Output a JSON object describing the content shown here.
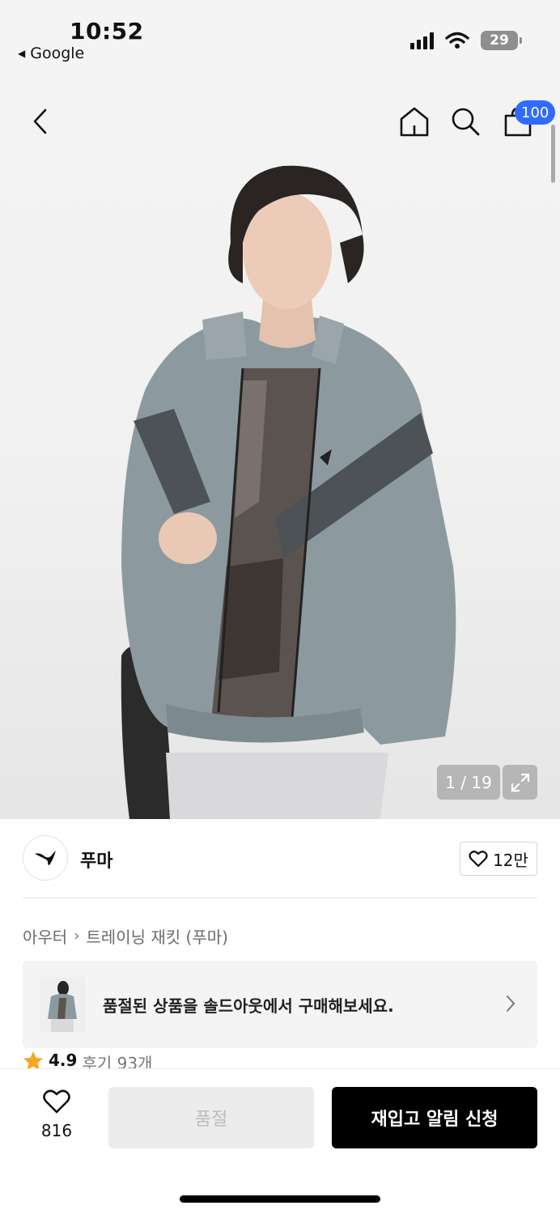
{
  "status_bar": {
    "time": "10:52",
    "back_app": "Google",
    "battery": "29"
  },
  "header": {
    "back_icon": "chevron-left-icon",
    "home_icon": "home-icon",
    "search_icon": "search-icon",
    "cart_icon": "shopping-bag-icon",
    "cart_count": "100"
  },
  "gallery": {
    "counter": "1 / 19",
    "expand_icon": "expand-icon"
  },
  "brand": {
    "name": "푸마",
    "likes": "12만"
  },
  "breadcrumb": {
    "category": "아우터",
    "subcategory": "트레이닝 재킷 (푸마)"
  },
  "soldout_banner": {
    "text": "품절된 상품을 솔드아웃에서 구매해보세요."
  },
  "rating": {
    "score": "4.9",
    "reviews": "후기 93개"
  },
  "bottom_bar": {
    "wish_count": "816",
    "soldout_label": "품절",
    "restock_label": "재입고 알림 신청"
  },
  "colors": {
    "accent_badge": "#2f6bff",
    "star": "#f5a623",
    "jacket": "#8c9aa0"
  }
}
